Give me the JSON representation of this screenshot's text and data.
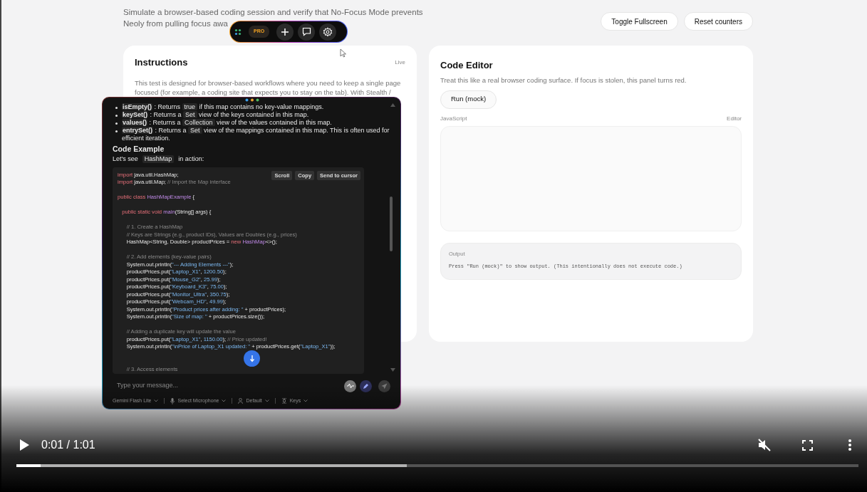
{
  "header": {
    "description": "Simulate a browser-based coding session and verify that No-Focus Mode prevents Neoly from pulling focus awa",
    "buttons": [
      "Toggle Fullscreen",
      "Reset counters"
    ]
  },
  "floating_toolbar": {
    "badge": "PRO"
  },
  "instructions": {
    "title": "Instructions",
    "status": "Live",
    "text": "This test is designed for browser-based workflows where you need to keep a single page focused (for example, a coding site that expects you to stay on the tab). With Stealth /"
  },
  "code_editor": {
    "title": "Code Editor",
    "description": "Treat this like a real browser coding surface. If focus is stolen, this panel turns red.",
    "run_button": "Run (mock)",
    "language_label": "JavaScript",
    "mode_label": "Editor",
    "output_label": "Output",
    "output_text": "Press \"Run (mock)\" to show output. (This intentionally does not execute code.)"
  },
  "chat_overlay": {
    "bullets": [
      [
        {
          "kind": "term",
          "t": "isEmpty()"
        },
        {
          "kind": "plain",
          "t": " : Returns "
        },
        {
          "kind": "code",
          "t": "true"
        },
        {
          "kind": "plain",
          "t": " if this map contains no key-value mappings."
        }
      ],
      [
        {
          "kind": "term",
          "t": "keySet()"
        },
        {
          "kind": "plain",
          "t": " : Returns a "
        },
        {
          "kind": "code",
          "t": "Set"
        },
        {
          "kind": "plain",
          "t": " view of the keys contained in this map."
        }
      ],
      [
        {
          "kind": "term",
          "t": "values()"
        },
        {
          "kind": "plain",
          "t": " : Returns a "
        },
        {
          "kind": "code",
          "t": "Collection"
        },
        {
          "kind": "plain",
          "t": " view of the values contained in this map."
        }
      ],
      [
        {
          "kind": "term",
          "t": "entrySet()"
        },
        {
          "kind": "plain",
          "t": " : Returns a "
        },
        {
          "kind": "code",
          "t": "Set"
        },
        {
          "kind": "plain",
          "t": " view of the mappings contained in this map. This is often used for efficient iteration."
        }
      ]
    ],
    "heading": "Code Example",
    "intro": [
      {
        "kind": "plain",
        "t": "Let's see "
      },
      {
        "kind": "code",
        "t": "HashMap"
      },
      {
        "kind": "plain",
        "t": " in action:"
      }
    ],
    "code_actions": [
      "Scroll",
      "Copy",
      "Send to cursor"
    ],
    "code_lines": [
      {
        "kind": "code",
        "tokens": [
          {
            "kind": "keyword",
            "t": "import"
          },
          {
            "kind": "plain",
            "t": " java.util.HashMap;"
          }
        ]
      },
      {
        "kind": "code",
        "tokens": [
          {
            "kind": "keyword",
            "t": "import"
          },
          {
            "kind": "plain",
            "t": " java.util.Map; "
          },
          {
            "kind": "comment",
            "t": "// Import the Map interface"
          }
        ]
      },
      {
        "kind": "blank"
      },
      {
        "kind": "code",
        "tokens": [
          {
            "kind": "keyword",
            "t": "public class "
          },
          {
            "kind": "type",
            "t": "HashMapExample"
          },
          {
            "kind": "plain",
            "t": " {"
          }
        ]
      },
      {
        "kind": "blank"
      },
      {
        "kind": "code",
        "tokens": [
          {
            "kind": "keyword",
            "t": "   public static void "
          },
          {
            "kind": "type",
            "t": "main"
          },
          {
            "kind": "plain",
            "t": "(String[] args) {"
          }
        ]
      },
      {
        "kind": "blank"
      },
      {
        "kind": "code",
        "tokens": [
          {
            "kind": "comment",
            "t": "      // 1. Create a HashMap"
          }
        ]
      },
      {
        "kind": "code",
        "tokens": [
          {
            "kind": "comment",
            "t": "      // Keys are Strings (e.g., product IDs), Values are Doubles (e.g., prices)"
          }
        ]
      },
      {
        "kind": "code",
        "tokens": [
          {
            "kind": "plain",
            "t": "      HashMap<String, Double> productPrices = "
          },
          {
            "kind": "keyword",
            "t": "new "
          },
          {
            "kind": "type",
            "t": "HashMap"
          },
          {
            "kind": "plain",
            "t": "<>();"
          }
        ]
      },
      {
        "kind": "blank"
      },
      {
        "kind": "code",
        "tokens": [
          {
            "kind": "comment",
            "t": "      // 2. Add elements (key-value pairs)"
          }
        ]
      },
      {
        "kind": "code",
        "tokens": [
          {
            "kind": "plain",
            "t": "      System.out.println("
          },
          {
            "kind": "string",
            "t": "\"--- Adding Elements ---\""
          },
          {
            "kind": "plain",
            "t": ");"
          }
        ]
      },
      {
        "kind": "code",
        "tokens": [
          {
            "kind": "plain",
            "t": "      productPrices.put("
          },
          {
            "kind": "string",
            "t": "\"Laptop_X1\""
          },
          {
            "kind": "plain",
            "t": ", "
          },
          {
            "kind": "number",
            "t": "1200.50"
          },
          {
            "kind": "plain",
            "t": ");"
          }
        ]
      },
      {
        "kind": "code",
        "tokens": [
          {
            "kind": "plain",
            "t": "      productPrices.put("
          },
          {
            "kind": "string",
            "t": "\"Mouse_G2\""
          },
          {
            "kind": "plain",
            "t": ", "
          },
          {
            "kind": "number",
            "t": "25.99"
          },
          {
            "kind": "plain",
            "t": ");"
          }
        ]
      },
      {
        "kind": "code",
        "tokens": [
          {
            "kind": "plain",
            "t": "      productPrices.put("
          },
          {
            "kind": "string",
            "t": "\"Keyboard_K3\""
          },
          {
            "kind": "plain",
            "t": ", "
          },
          {
            "kind": "number",
            "t": "75.00"
          },
          {
            "kind": "plain",
            "t": ");"
          }
        ]
      },
      {
        "kind": "code",
        "tokens": [
          {
            "kind": "plain",
            "t": "      productPrices.put("
          },
          {
            "kind": "string",
            "t": "\"Monitor_Ultra\""
          },
          {
            "kind": "plain",
            "t": ", "
          },
          {
            "kind": "number",
            "t": "350.75"
          },
          {
            "kind": "plain",
            "t": ");"
          }
        ]
      },
      {
        "kind": "code",
        "tokens": [
          {
            "kind": "plain",
            "t": "      productPrices.put("
          },
          {
            "kind": "string",
            "t": "\"Webcam_HD\""
          },
          {
            "kind": "plain",
            "t": ", "
          },
          {
            "kind": "number",
            "t": "49.99"
          },
          {
            "kind": "plain",
            "t": ");"
          }
        ]
      },
      {
        "kind": "code",
        "tokens": [
          {
            "kind": "plain",
            "t": "      System.out.println("
          },
          {
            "kind": "string",
            "t": "\"Product prices after adding: \""
          },
          {
            "kind": "plain",
            "t": " + productPrices);"
          }
        ]
      },
      {
        "kind": "code",
        "tokens": [
          {
            "kind": "plain",
            "t": "      System.out.println("
          },
          {
            "kind": "string",
            "t": "\"Size of map: \""
          },
          {
            "kind": "plain",
            "t": " + productPrices.size());"
          }
        ]
      },
      {
        "kind": "blank"
      },
      {
        "kind": "code",
        "tokens": [
          {
            "kind": "comment",
            "t": "      // Adding a duplicate key will update the value"
          }
        ]
      },
      {
        "kind": "code",
        "tokens": [
          {
            "kind": "plain",
            "t": "      productPrices.put("
          },
          {
            "kind": "string",
            "t": "\"Laptop_X1\""
          },
          {
            "kind": "plain",
            "t": ", "
          },
          {
            "kind": "number",
            "t": "1150.00"
          },
          {
            "kind": "plain",
            "t": "); "
          },
          {
            "kind": "comment",
            "t": "// Price updated!"
          }
        ]
      },
      {
        "kind": "code",
        "tokens": [
          {
            "kind": "plain",
            "t": "      System.out.println("
          },
          {
            "kind": "string",
            "t": "\"\\nPrice of Laptop_X1 updated: \""
          },
          {
            "kind": "plain",
            "t": " + productPrices.get("
          },
          {
            "kind": "string",
            "t": "\"Laptop_X1\""
          },
          {
            "kind": "plain",
            "t": "));"
          }
        ]
      },
      {
        "kind": "blank"
      },
      {
        "kind": "blank"
      },
      {
        "kind": "code",
        "tokens": [
          {
            "kind": "comment",
            "t": "      // 3. Access elements"
          }
        ]
      }
    ],
    "input": {
      "placeholder": "Type your message..."
    },
    "footer": [
      {
        "kind": "model",
        "label": "Gemini Flash Lite"
      },
      {
        "kind": "microphone",
        "label": "Select Microphone"
      },
      {
        "kind": "profile",
        "label": "Default"
      },
      {
        "kind": "keys",
        "label": "Keys"
      }
    ]
  },
  "video_controls": {
    "time": "0:01 / 1:01",
    "muted": true,
    "progress": {
      "level": 0.029
    },
    "buffer": {
      "level": 0.464
    }
  }
}
